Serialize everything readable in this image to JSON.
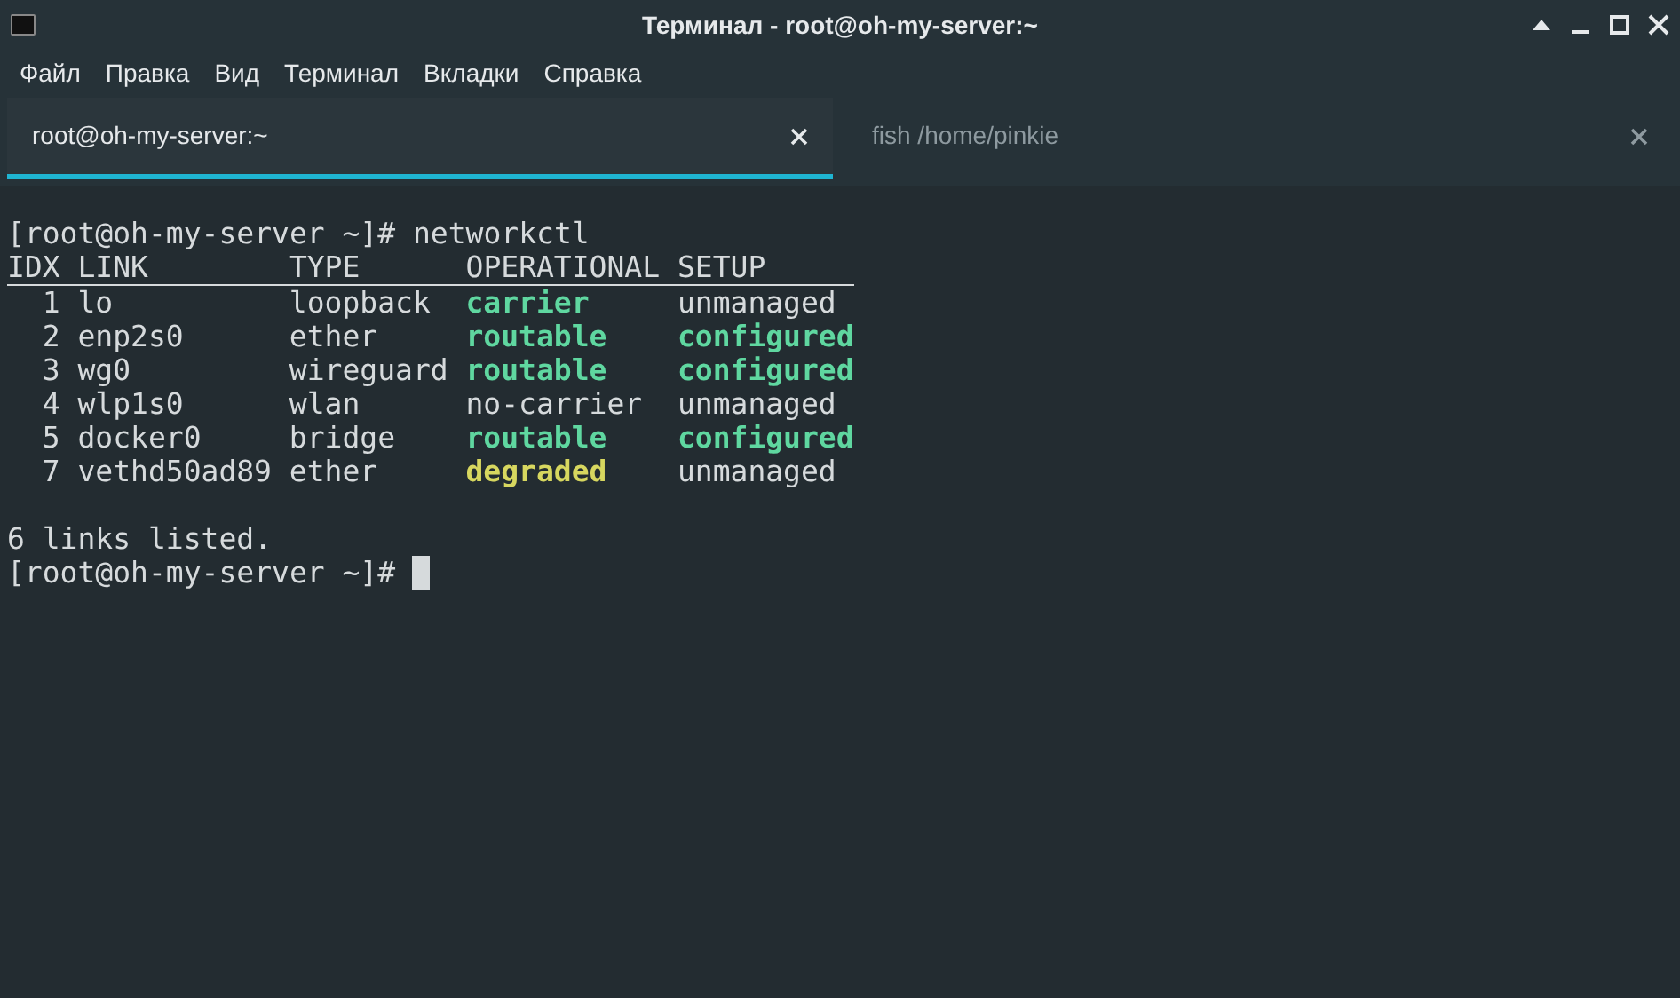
{
  "window": {
    "title": "Терминал - root@oh-my-server:~"
  },
  "menu": [
    "Файл",
    "Правка",
    "Вид",
    "Терминал",
    "Вкладки",
    "Справка"
  ],
  "tabs": [
    {
      "label": "root@oh-my-server:~",
      "selected": true
    },
    {
      "label": "fish /home/pinkie",
      "selected": false
    }
  ],
  "terminal": {
    "prompt_1": "[root@oh-my-server ~]#",
    "command": "networkctl",
    "columns": [
      "IDX",
      "LINK",
      "TYPE",
      "OPERATIONAL",
      "SETUP"
    ],
    "rows": [
      {
        "idx": "1",
        "link": "lo",
        "type": "loopback",
        "operational": {
          "text": "carrier",
          "color": "#5fd7a0"
        },
        "setup": {
          "text": "unmanaged"
        }
      },
      {
        "idx": "2",
        "link": "enp2s0",
        "type": "ether",
        "operational": {
          "text": "routable",
          "color": "#5fd7a0"
        },
        "setup": {
          "text": "configured",
          "color": "#5fd7a0"
        }
      },
      {
        "idx": "3",
        "link": "wg0",
        "type": "wireguard",
        "operational": {
          "text": "routable",
          "color": "#5fd7a0"
        },
        "setup": {
          "text": "configured",
          "color": "#5fd7a0"
        }
      },
      {
        "idx": "4",
        "link": "wlp1s0",
        "type": "wlan",
        "operational": {
          "text": "no-carrier"
        },
        "setup": {
          "text": "unmanaged"
        }
      },
      {
        "idx": "5",
        "link": "docker0",
        "type": "bridge",
        "operational": {
          "text": "routable",
          "color": "#5fd7a0"
        },
        "setup": {
          "text": "configured",
          "color": "#5fd7a0"
        }
      },
      {
        "idx": "7",
        "link": "vethd50ad89",
        "type": "ether",
        "operational": {
          "text": "degraded",
          "color": "#d7d75f"
        },
        "setup": {
          "text": "unmanaged"
        }
      }
    ],
    "summary": "6 links listed.",
    "prompt_2": "[root@oh-my-server ~]#"
  }
}
